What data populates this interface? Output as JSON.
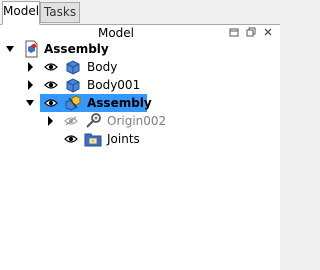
{
  "tabs": [
    {
      "label": "Model",
      "active": true
    },
    {
      "label": "Tasks",
      "active": false
    }
  ],
  "panel": {
    "title": "Model",
    "buttons": [
      "float-panel",
      "restore-panel",
      "close-panel"
    ]
  },
  "tree": {
    "root": {
      "label": "Assembly",
      "icon": "assembly-document-icon",
      "expanded": true
    },
    "items": [
      {
        "label": "Body",
        "icon": "part-body-icon",
        "visible": true,
        "expanded": false
      },
      {
        "label": "Body001",
        "icon": "part-body-icon",
        "visible": true,
        "expanded": false
      },
      {
        "label": "Assembly",
        "icon": "assembly-icon",
        "visible": true,
        "expanded": true,
        "selected": true
      },
      {
        "label": "Origin002",
        "icon": "origin-icon",
        "visible": false,
        "expanded": false,
        "greyed": true
      },
      {
        "label": "Joints",
        "icon": "joints-folder-icon",
        "visible": true,
        "expanded": false
      }
    ]
  },
  "colors": {
    "selection": "#3399ff",
    "greyed_text": "#808080"
  }
}
